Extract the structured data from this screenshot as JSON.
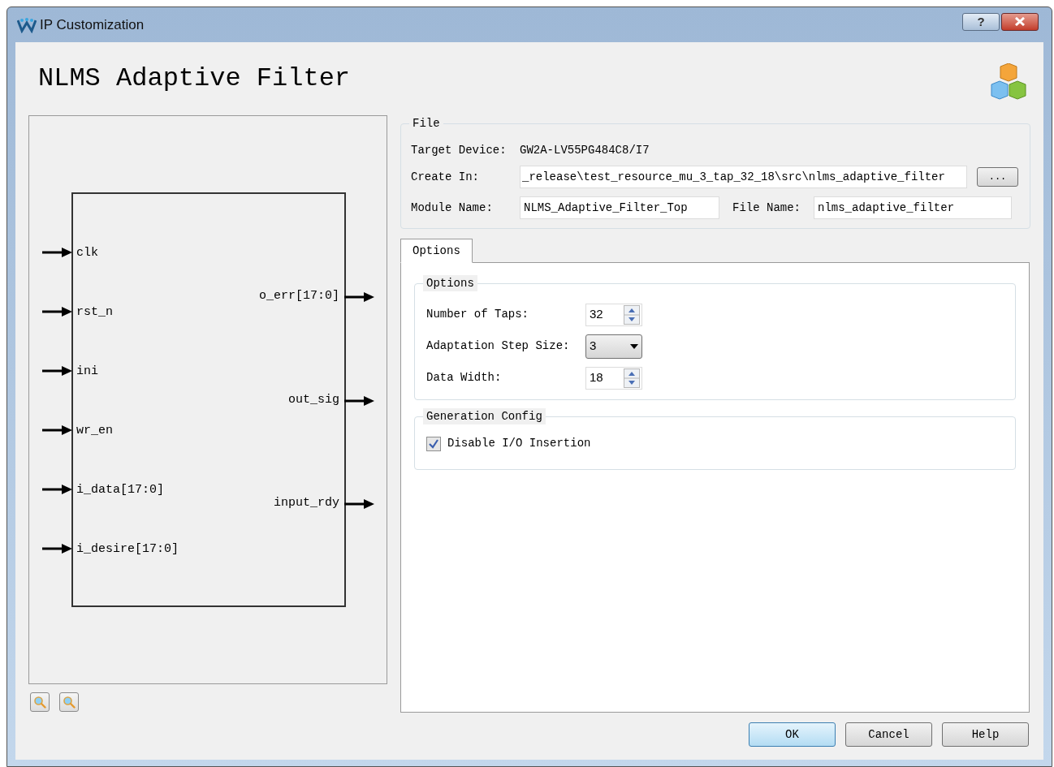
{
  "window": {
    "title": "IP Customization",
    "help_button": "?"
  },
  "heading": "NLMS Adaptive Filter",
  "diagram": {
    "left_pins": [
      {
        "label": "clk"
      },
      {
        "label": "rst_n"
      },
      {
        "label": "ini"
      },
      {
        "label": "wr_en"
      },
      {
        "label": "i_data[17:0]"
      },
      {
        "label": "i_desire[17:0]"
      }
    ],
    "right_pins": [
      {
        "label": "o_err[17:0]"
      },
      {
        "label": "out_sig"
      },
      {
        "label": "input_rdy"
      }
    ]
  },
  "file": {
    "title": "File",
    "target_device_label": "Target Device:",
    "target_device": "GW2A-LV55PG484C8/I7",
    "create_in_label": "Create In:",
    "create_in": "_release\\test_resource_mu_3_tap_32_18\\src\\nlms_adaptive_filter",
    "browse": "...",
    "module_name_label": "Module Name:",
    "module_name": "NLMS_Adaptive_Filter_Top",
    "file_name_label": "File Name:",
    "file_name": "nlms_adaptive_filter"
  },
  "tabs": [
    {
      "label": "Options",
      "selected": true
    }
  ],
  "options": {
    "title": "Options",
    "fields": [
      {
        "kind": "spin",
        "label": "Number of Taps:",
        "value": "32"
      },
      {
        "kind": "combo",
        "label": "Adaptation Step Size:",
        "value": "3"
      },
      {
        "kind": "spin",
        "label": "Data Width:",
        "value": "18"
      }
    ]
  },
  "generation": {
    "title": "Generation Config",
    "checkboxes": [
      {
        "label": "Disable I/O Insertion",
        "checked": true
      }
    ]
  },
  "buttons": [
    {
      "label": "OK",
      "selected": true
    },
    {
      "label": "Cancel",
      "selected": false
    },
    {
      "label": "Help",
      "selected": false
    }
  ]
}
